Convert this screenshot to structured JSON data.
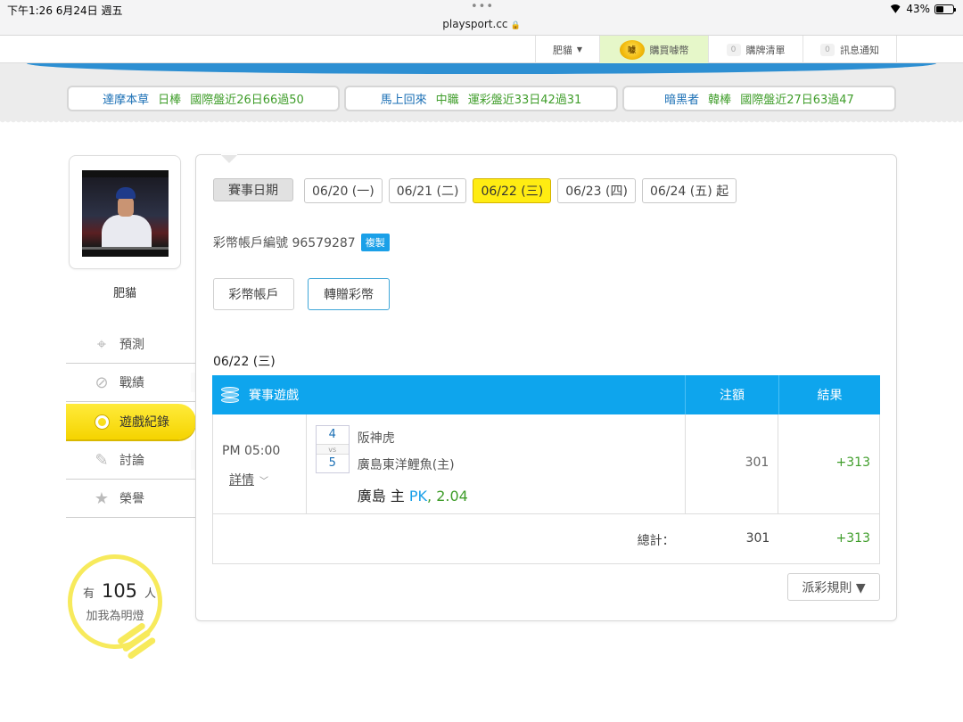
{
  "statusbar": {
    "time": "下午1:26   6月24日 週五",
    "url": "playsport.cc",
    "battery": "43%",
    "battery_level": 0.43
  },
  "topnav": {
    "user": "肥貓",
    "buy": "購買噱幣",
    "buy_coin": "噱",
    "cart_count": "0",
    "cart": "購牌清單",
    "notice_count": "0",
    "notice": "訊息通知"
  },
  "tips": [
    {
      "name": "達摩本草",
      "kind": "日棒",
      "record": "國際盤近26日66過50"
    },
    {
      "name": "馬上回來",
      "kind": "中職",
      "record": "運彩盤近33日42過31"
    },
    {
      "name": "暗黑者",
      "kind": "韓棒",
      "record": "國際盤近27日63過47"
    }
  ],
  "profile": {
    "nickname": "肥貓"
  },
  "menu": {
    "predict": "預測",
    "record": "戰績",
    "game_history": "遊戲紀錄",
    "discuss": "討論",
    "honor": "榮譽"
  },
  "bulb": {
    "prefix": "有",
    "count": "105",
    "suffix": "人",
    "text": "加我為明燈"
  },
  "dates": {
    "label": "賽事日期",
    "items": [
      "06/20 (一)",
      "06/21 (二)",
      "06/22 (三)",
      "06/23 (四)",
      "06/24 (五) 起"
    ],
    "active": "06/22 (三)"
  },
  "account": {
    "label": "彩幣帳戶編號 96579287",
    "copy": "複製"
  },
  "buttons": {
    "account": "彩幣帳戶",
    "transfer": "轉贈彩幣"
  },
  "game_date": "06/22 (三)",
  "table": {
    "headers": {
      "game": "賽事遊戲",
      "bet": "注額",
      "result": "結果"
    },
    "row": {
      "time": "PM 05:00",
      "detail": "詳情",
      "score_away": "4",
      "vs": "vs",
      "score_home": "5",
      "team_away": "阪神虎",
      "team_home": "廣島東洋鯉魚(主)",
      "pick_team": "廣島 主",
      "pick_type": "PK",
      "pick_odds": ", 2.04",
      "bet": "301",
      "result": "+313"
    },
    "total": {
      "label": "總計：",
      "bet": "301",
      "result": "+313"
    }
  },
  "rules": "派彩規則 ▼",
  "colors": {
    "accent_blue": "#0ea5ed",
    "active_yellow": "#ffec12",
    "win_green": "#3f9d2a",
    "link_blue": "#1a6fb5"
  }
}
